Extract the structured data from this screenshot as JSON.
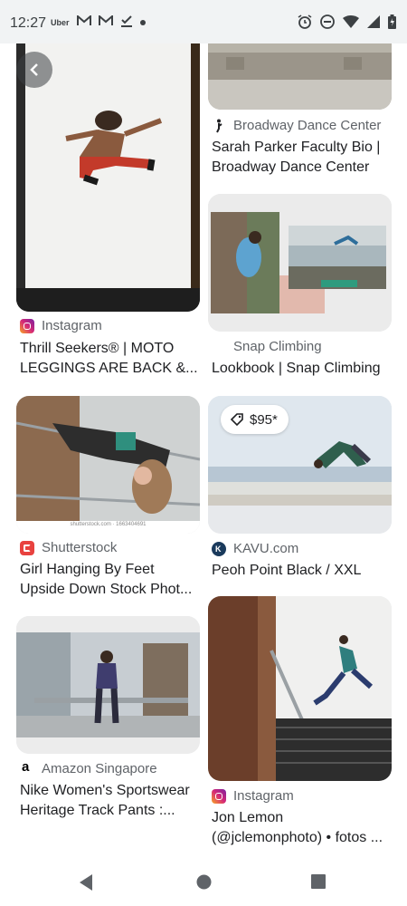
{
  "status_bar": {
    "time": "12:27",
    "left_icons": [
      "uber-icon",
      "gmail-icon",
      "gmail-icon",
      "tasks-check-icon",
      "dot-icon"
    ],
    "uber_label": "Uber",
    "right_icons": [
      "alarm-icon",
      "do-not-disturb-icon",
      "wifi-icon",
      "signal-icon",
      "battery-icon"
    ]
  },
  "results": [
    {
      "id": "moto-leggings",
      "source": "Instagram",
      "source_icon": "instagram-icon",
      "title_line1": "Thrill Seekers® | MOTO",
      "title_line2": "LEGGINGS ARE BACK &..."
    },
    {
      "id": "broadway",
      "source": "Broadway Dance Center",
      "source_icon": "dancer-icon",
      "title_line1": "Sarah Parker Faculty Bio |",
      "title_line2": "Broadway Dance Center"
    },
    {
      "id": "snap-climbing",
      "source": "Snap Climbing",
      "source_icon": "",
      "title_line1": "Lookbook | Snap Climbing",
      "title_line2": ""
    },
    {
      "id": "shutterstock",
      "source": "Shutterstock",
      "source_icon": "shutterstock-icon",
      "title_line1": "Girl Hanging By Feet",
      "title_line2": "Upside Down Stock Phot...",
      "watermark": "shutterstock.com · 1663404691"
    },
    {
      "id": "kavu",
      "source": "KAVU.com",
      "source_icon": "kavu-icon",
      "title_line1": "Peoh Point Black / XXL",
      "title_line2": "",
      "price": "$95*"
    },
    {
      "id": "amazon",
      "source": "Amazon Singapore",
      "source_icon": "amazon-icon",
      "title_line1": "Nike Women's Sportswear",
      "title_line2": "Heritage Track Pants :..."
    },
    {
      "id": "jon-lemon",
      "source": "Instagram",
      "source_icon": "instagram-icon",
      "title_line1": "Jon Lemon",
      "title_line2": "(@jclemonphoto) • fotos ..."
    }
  ],
  "nav": {
    "back": "back-triangle-icon",
    "home": "home-circle-icon",
    "recents": "recents-square-icon"
  },
  "colors": {
    "instagram": "#d62976",
    "shutterstock": "#e8423f",
    "kavu": "#1a3a5c",
    "amazon": "#000000",
    "status_bar": "#f1f3f4"
  }
}
